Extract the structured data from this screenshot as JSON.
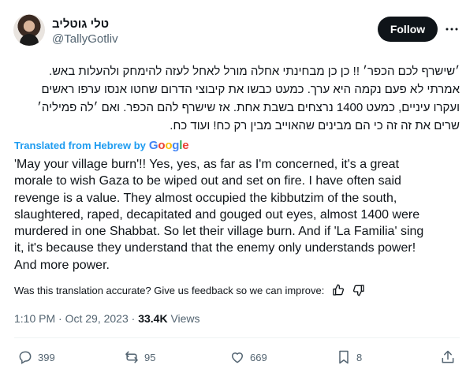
{
  "author": {
    "display_name": "טלי גוטליב",
    "handle": "@TallyGotliv",
    "avatar_icon": "profile-photo"
  },
  "follow_label": "Follow",
  "more_icon": "more-horizontal-icon",
  "original_text_lines": [
    "׳שישרף לכם הכפר׳ !! כן כן מבחינתי אחלה מורל לאחל לעזה להימחק ולהעלות באש.",
    "אמרתי לא פעם נקמה היא ערך. כמעט כבשו את קיבוצי הדרום שחטו אנסו ערפו ראשים",
    "ועקרו עיניים, כמעט 1400 נרצחים בשבת אחת. אז שישרף להם הכפר. ואם ׳לה פמיליה׳",
    "שרים את זה זה כי הם מבינים שהאוייב מבין רק כח! ועוד כח."
  ],
  "translated_from": "Translated from Hebrew by",
  "google_logo": [
    "G",
    "o",
    "o",
    "g",
    "l",
    "e"
  ],
  "translation_lines": [
    "'May your village burn'!! Yes, yes, as far as I'm concerned, it's a great",
    "morale to wish Gaza to be wiped out and set on fire. I have often said",
    "revenge is a value. They almost occupied the kibbutzim of the south,",
    "slaughtered, raped, decapitated and gouged out eyes, almost 1400 were",
    "murdered in one Shabbat. So let their village burn. And if 'La Familia' sing",
    "it, it's because they understand that the enemy only understands power!",
    "And more power."
  ],
  "feedback_prompt": "Was this translation accurate? Give us feedback so we can improve:",
  "timestamp": "1:10 PM · Oct 29, 2023",
  "views_count": "33.4K",
  "views_label": "Views",
  "meta_separator": "·",
  "actions": {
    "replies": "399",
    "reposts": "95",
    "likes": "669",
    "bookmarks": "8"
  },
  "colors": {
    "accent": "#1d9bf0",
    "text": "#0f1419",
    "muted": "#536471",
    "follow_bg": "#0f1419"
  }
}
